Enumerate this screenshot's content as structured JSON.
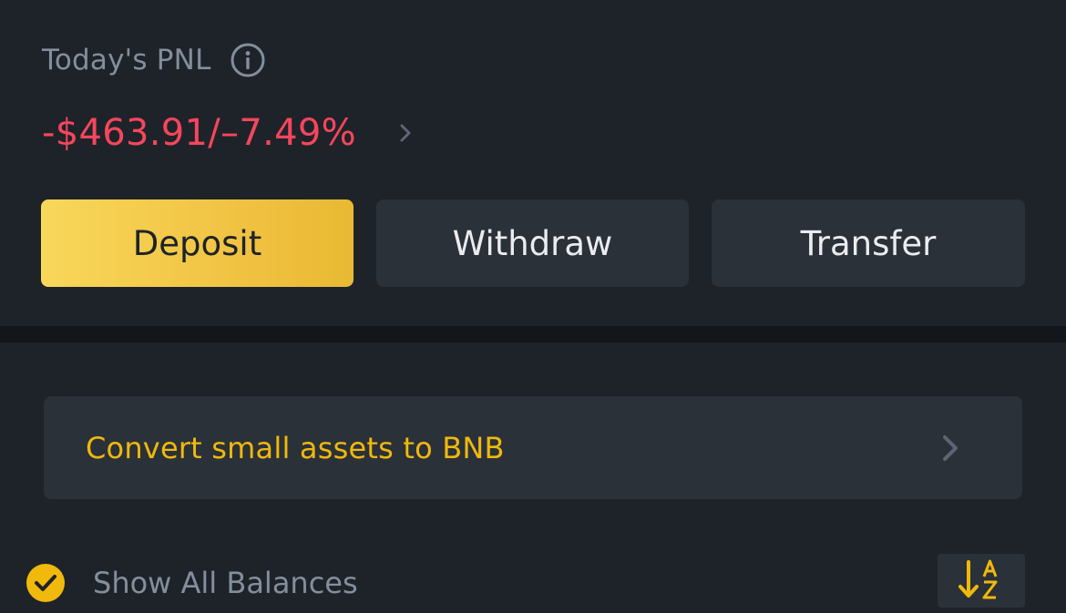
{
  "pnl": {
    "label": "Today's PNL",
    "value": "-$463.91/–7.49%"
  },
  "actions": {
    "deposit_label": "Deposit",
    "withdraw_label": "Withdraw",
    "transfer_label": "Transfer"
  },
  "convert": {
    "label": "Convert small assets to BNB"
  },
  "balances": {
    "show_all_label": "Show All Balances",
    "show_all_checked": true
  },
  "icons": {
    "info": "info-icon",
    "pnl_chevron": "chevron-right-icon",
    "convert_chevron": "chevron-right-icon",
    "check": "check-circle-icon",
    "sort": "sort-a-z-icon"
  },
  "colors": {
    "background": "#1e2329",
    "panel": "#2b3139",
    "accent_yellow": "#f0b90b",
    "negative_red": "#f6465d",
    "muted_text": "#848e9c",
    "primary_text": "#eaecef"
  }
}
